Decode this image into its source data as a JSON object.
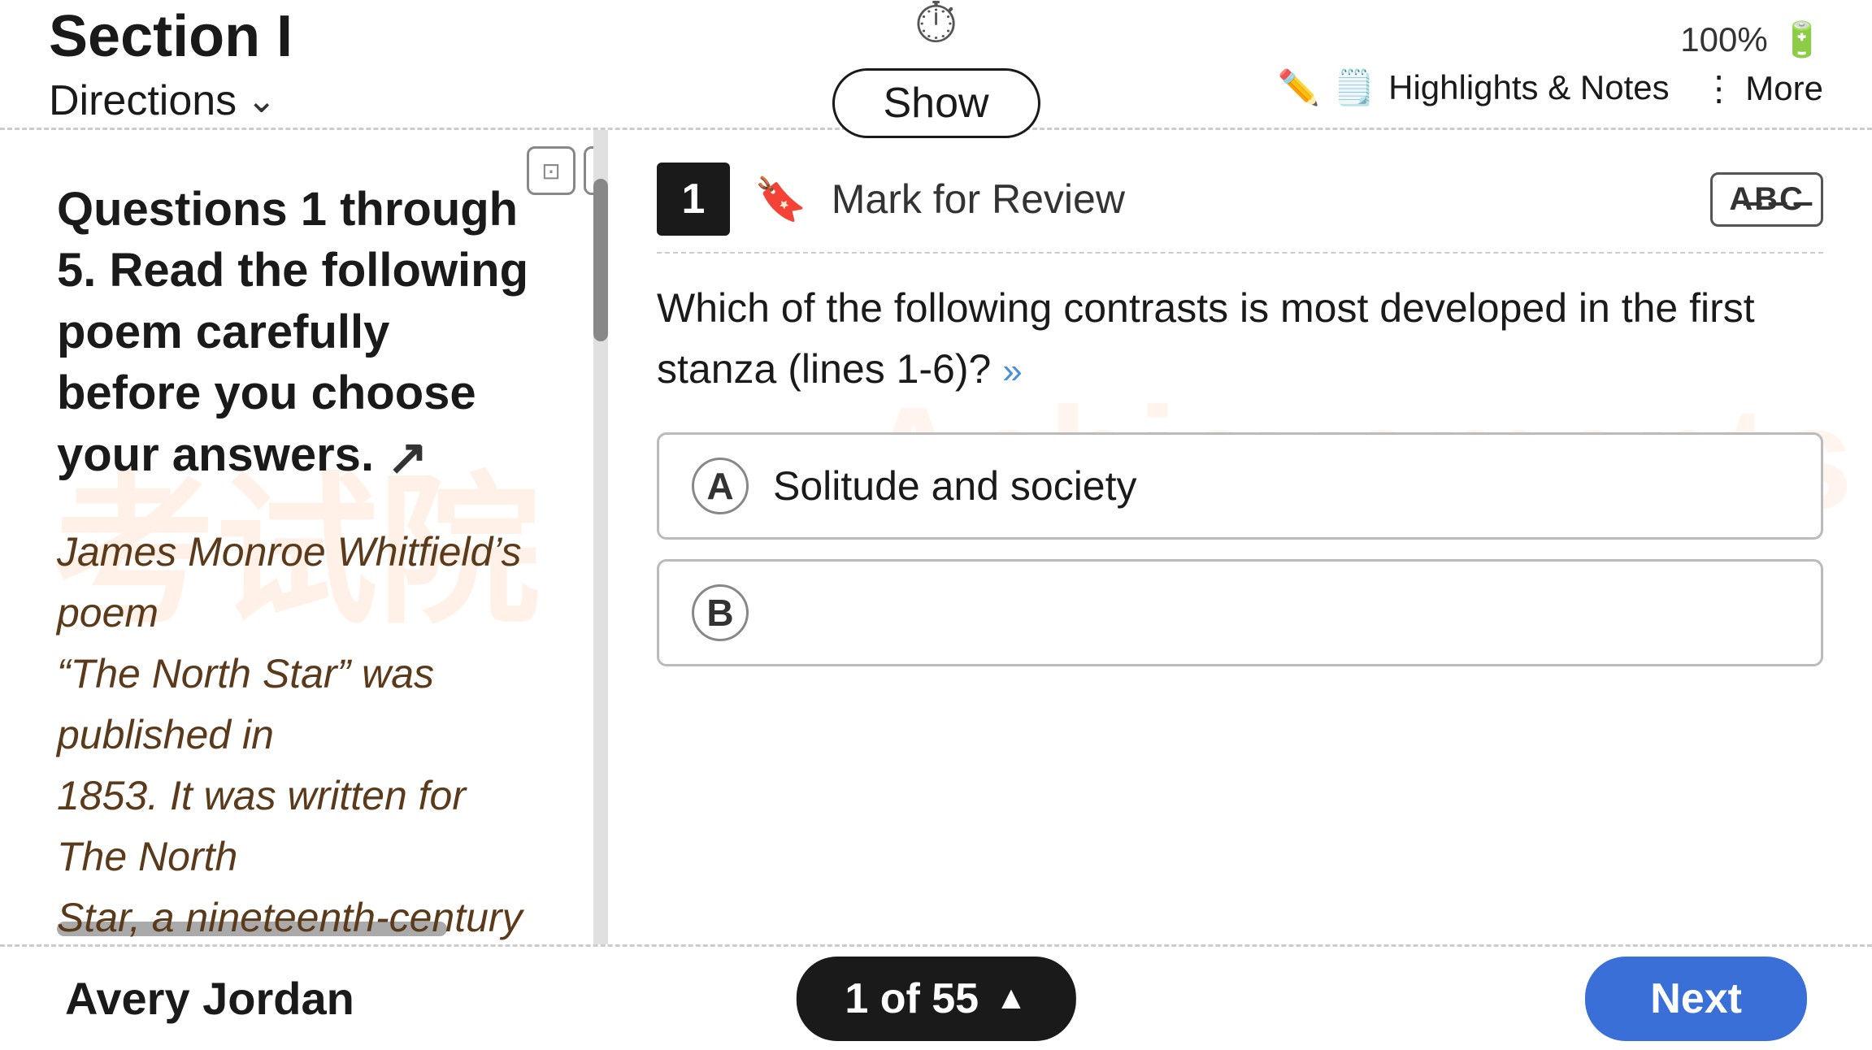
{
  "header": {
    "section_title": "Section I",
    "directions_label": "Directions",
    "timer_icon": "⏱",
    "show_label": "Show",
    "battery_pct": "100%",
    "highlights_notes_label": "Highlights & Notes",
    "more_label": "More"
  },
  "left_panel": {
    "heading": "Questions 1 through 5. Read the following poem carefully before you choose your answers.",
    "subtitle_line1": "James Monroe Whitfield’s poem",
    "subtitle_line2": "“The North Star” was published in",
    "subtitle_line3": "1853. It was written for The North",
    "subtitle_line4": "Star, a nineteenth-century"
  },
  "right_panel": {
    "question_number": "1",
    "mark_review_label": "Mark for Review",
    "abc_label": "A̸B̸C̸",
    "question_text": "Which of the following contrasts is most developed in the first stanza (lines 1-6)?",
    "expand_icon": "»",
    "options": [
      {
        "letter": "A",
        "text": "Solitude and society"
      },
      {
        "letter": "B",
        "text": ""
      }
    ]
  },
  "footer": {
    "student_name": "Avery Jordan",
    "pagination_label": "1 of 55",
    "caret": "▲",
    "next_label": "Next"
  },
  "watermark": {
    "left": "考试院",
    "right": "Achievements"
  }
}
